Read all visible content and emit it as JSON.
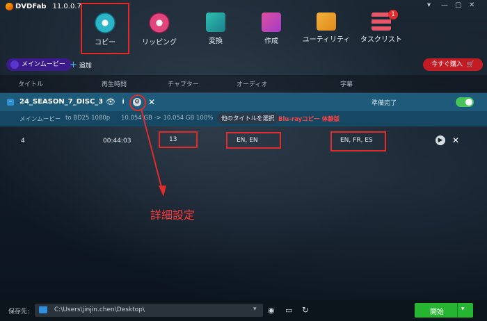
{
  "app": {
    "brand": "DVDFab",
    "version": "11.0.0.7"
  },
  "nav": [
    {
      "label": "コピー"
    },
    {
      "label": "リッピング"
    },
    {
      "label": "変換"
    },
    {
      "label": "作成"
    },
    {
      "label": "ユーティリティ"
    },
    {
      "label": "タスクリスト",
      "badge": "1"
    }
  ],
  "toolbar": {
    "main_movie": "メインムービー",
    "add": "追加",
    "buy": "今すぐ購入"
  },
  "columns": [
    "タイトル",
    "再生時間",
    "チャプター",
    "オーディオ",
    "字幕"
  ],
  "disc": {
    "name": "24_SEASON_7_DISC_3",
    "status": "準備完了",
    "sub_mode": "メインムービー",
    "sub_target": "to BD25 1080p",
    "sub_size": "10.054 GB -> 10.054 GB 100%",
    "other_titles": "他のタイトルを選択",
    "trial": "Blu-rayコピー 体験版"
  },
  "row": {
    "title": "4",
    "duration": "00:44:03",
    "chapters": "13",
    "audio": "EN, EN",
    "subtitles": "EN, FR, ES"
  },
  "annotation": "詳細設定",
  "bottom": {
    "save_label": "保存先:",
    "path": "C:\\Users\\jinjin.chen\\Desktop\\",
    "start": "開始"
  },
  "colors": {
    "accent_red": "#e22b2b",
    "start_green": "#25b530",
    "title_row": "#1e5b7a"
  }
}
